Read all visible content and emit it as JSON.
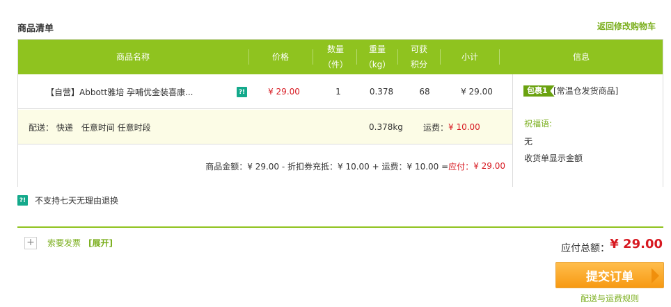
{
  "header": {
    "title": "商品清单",
    "back_link": "返回修改购物车"
  },
  "table": {
    "columns": {
      "name": "商品名称",
      "price": "价格",
      "qty_line1": "数量",
      "qty_line2": "（件）",
      "weight_line1": "重量",
      "weight_line2": "（kg）",
      "points_line1": "可获",
      "points_line2": "积分",
      "subtotal": "小计",
      "info": "信息"
    },
    "item": {
      "name": "【自营】Abbott雅培 孕哺优金装喜康...",
      "tag_icon": "?!",
      "price": "¥ 29.00",
      "qty": "1",
      "weight": "0.378",
      "points": "68",
      "subtotal": "¥ 29.00"
    },
    "delivery": {
      "text": "配送： 快递　任意时间 任意时段",
      "weight": "0.378kg",
      "fee_label": "运费：",
      "fee_value": "¥ 10.00"
    },
    "summary": {
      "text": "商品金额：¥ 29.00 - 折扣券充抵：¥ 10.00 + 运费：¥ 10.00 = ",
      "due_label": "应付：",
      "due_value": "¥ 29.00"
    },
    "info": {
      "badge": "包裹1",
      "badge_desc": "[常温仓发货商品]",
      "greeting_label": "祝福语:",
      "greeting_value": "无",
      "receipt_note": "收货单显示金额"
    }
  },
  "notice": {
    "icon": "?!",
    "text": "不支持七天无理由退换"
  },
  "invoice": {
    "toggle": "+",
    "label": "索要发票",
    "expand": "[展开]"
  },
  "total": {
    "label": "应付总额：",
    "value": "¥ 29.00"
  },
  "actions": {
    "submit": "提交订单",
    "rules": "配送与运费规则"
  },
  "colors": {
    "accent_green": "#8fc31f",
    "price_red": "#d71921",
    "submit_orange": "#f79a12"
  }
}
